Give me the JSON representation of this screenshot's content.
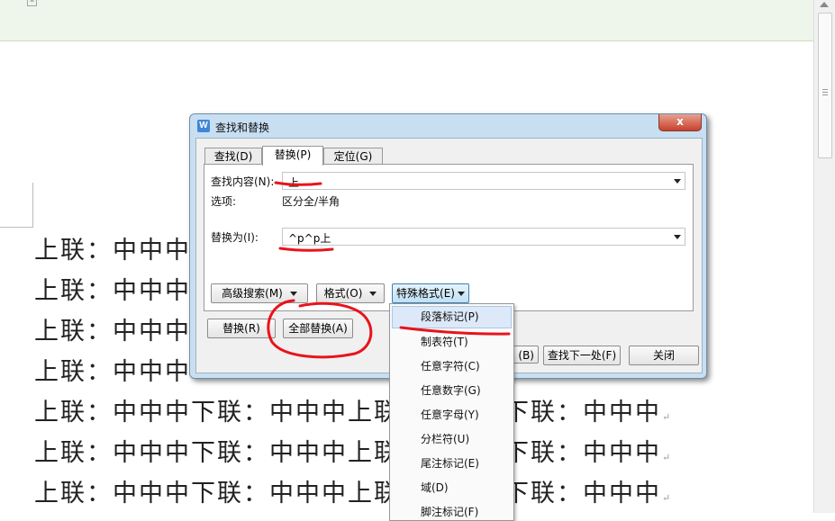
{
  "document": {
    "lines": [
      "上联：中中中",
      "上联：中中中",
      "上联：中中中",
      "上联：中中中",
      "上联：中中中下联：中中中上联：中中中下联：中中中",
      "上联：中中中下联：中中中上联：中中中下联：中中中",
      "上联：中中中下联：中中中上联：中中中下联：中中中"
    ]
  },
  "dialog": {
    "title": "查找和替换",
    "app_icon": "W",
    "close_label": "x",
    "tabs": [
      "查找(D)",
      "替换(P)",
      "定位(G)"
    ],
    "active_tab": "替换(P)",
    "find_label": "查找内容(N):",
    "find_value": "上",
    "options_label": "选项:",
    "options_value": "区分全/半角",
    "replace_label": "替换为(I):",
    "replace_value": "^p^p上",
    "advanced_search_label": "高级搜索(M)",
    "format_label": "格式(O)",
    "special_format_label": "特殊格式(E)",
    "replace_button": "替换(R)",
    "replace_all_button": "全部替换(A)",
    "partial_button": "(B)",
    "find_next_button": "查找下一处(F)",
    "close_button": "关闭"
  },
  "special_menu": {
    "items": [
      "段落标记(P)",
      "制表符(T)",
      "任意字符(C)",
      "任意数字(G)",
      "任意字母(Y)",
      "分栏符(U)",
      "尾注标记(E)",
      "域(D)",
      "脚注标记(F)"
    ]
  },
  "colors": {
    "annotation": "#e8141b",
    "menu_highlight": "#dde9f8",
    "ribbon": "#eef5ea"
  }
}
